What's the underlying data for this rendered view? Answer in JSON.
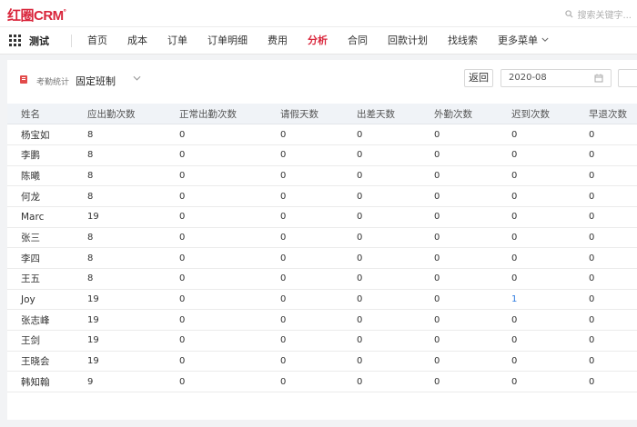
{
  "app": {
    "logo": "红圈CRM",
    "logo_mark": "°",
    "search_placeholder": "搜索关键字..."
  },
  "nav": {
    "workspace": "测试",
    "items": [
      {
        "label": "首页",
        "active": false
      },
      {
        "label": "成本",
        "active": false
      },
      {
        "label": "订单",
        "active": false
      },
      {
        "label": "订单明细",
        "active": false
      },
      {
        "label": "费用",
        "active": false
      },
      {
        "label": "分析",
        "active": true
      },
      {
        "label": "合同",
        "active": false
      },
      {
        "label": "回款计划",
        "active": false
      },
      {
        "label": "找线索",
        "active": false
      },
      {
        "label": "更多菜单",
        "active": false,
        "dropdown": true
      }
    ]
  },
  "report": {
    "category": "考勤统计",
    "name": "固定班制",
    "back_label": "返回",
    "month": "2020-08"
  },
  "table": {
    "columns": [
      "姓名",
      "应出勤次数",
      "正常出勤次数",
      "请假天数",
      "出差天数",
      "外勤次数",
      "迟到次数",
      "早退次数"
    ],
    "rows": [
      [
        "杨宝如",
        "8",
        "0",
        "0",
        "0",
        "0",
        "0",
        "0"
      ],
      [
        "李鹏",
        "8",
        "0",
        "0",
        "0",
        "0",
        "0",
        "0"
      ],
      [
        "陈曦",
        "8",
        "0",
        "0",
        "0",
        "0",
        "0",
        "0"
      ],
      [
        "何龙",
        "8",
        "0",
        "0",
        "0",
        "0",
        "0",
        "0"
      ],
      [
        "Marc",
        "19",
        "0",
        "0",
        "0",
        "0",
        "0",
        "0"
      ],
      [
        "张三",
        "8",
        "0",
        "0",
        "0",
        "0",
        "0",
        "0"
      ],
      [
        "李四",
        "8",
        "0",
        "0",
        "0",
        "0",
        "0",
        "0"
      ],
      [
        "王五",
        "8",
        "0",
        "0",
        "0",
        "0",
        "0",
        "0"
      ],
      [
        "Joy",
        "19",
        "0",
        "0",
        "0",
        "0",
        "1",
        "0"
      ],
      [
        "张志峰",
        "19",
        "0",
        "0",
        "0",
        "0",
        "0",
        "0"
      ],
      [
        "王剑",
        "19",
        "0",
        "0",
        "0",
        "0",
        "0",
        "0"
      ],
      [
        "王晓会",
        "19",
        "0",
        "0",
        "0",
        "0",
        "0",
        "0"
      ],
      [
        "韩知翰",
        "9",
        "0",
        "0",
        "0",
        "0",
        "0",
        "0"
      ]
    ]
  },
  "colors": {
    "accent": "#d9253b",
    "link": "#2d7be0",
    "header_bg": "#f0f3f7"
  }
}
